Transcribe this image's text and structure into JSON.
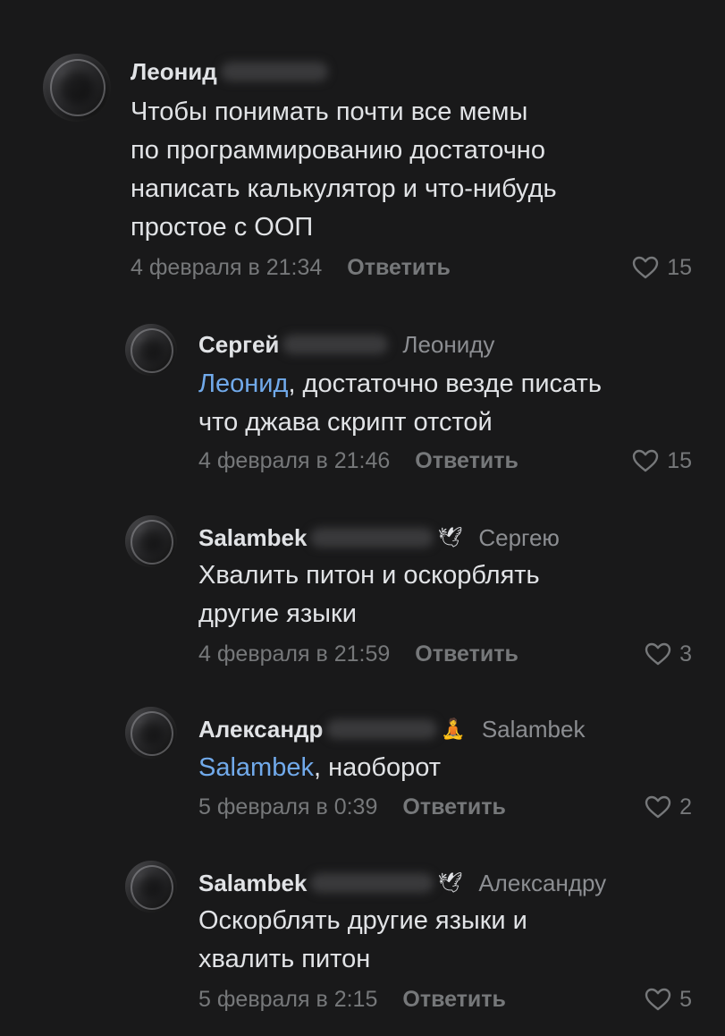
{
  "comments": [
    {
      "author": "Леонид",
      "reply_to": "",
      "text_lines": [
        "Чтобы понимать почти все мемы",
        "по программированию достаточно",
        "написать калькулятор и что-нибудь",
        "простое с ООП"
      ],
      "date": "4 февраля в 21:34",
      "reply_label": "Ответить",
      "likes": "15"
    },
    {
      "author": "Сергей",
      "reply_to": "Леониду",
      "mention": "Леонид",
      "text_first_rest": ", достаточно везде писать",
      "text_lines": [
        "что джава скрипт отстой"
      ],
      "date": "4 февраля в 21:46",
      "reply_label": "Ответить",
      "likes": "15"
    },
    {
      "author": "Salambek",
      "emoji": "🕊",
      "reply_to": "Сергею",
      "text_lines": [
        "Хвалить питон и оскорблять",
        "другие языки"
      ],
      "date": "4 февраля в 21:59",
      "reply_label": "Ответить",
      "likes": "3"
    },
    {
      "author": "Александр",
      "emoji": "🧘",
      "reply_to": "Salambek",
      "mention": "Salambek",
      "text_first_rest": ", наоборот",
      "date": "5 февраля в 0:39",
      "reply_label": "Ответить",
      "likes": "2"
    },
    {
      "author": "Salambek",
      "emoji": "🕊",
      "reply_to": "Александру",
      "text_lines": [
        "Оскорблять другие языки и",
        "хвалить питон"
      ],
      "date": "5 февраля в 2:15",
      "reply_label": "Ответить",
      "likes": "5"
    }
  ],
  "icons": {
    "like": "heart-icon"
  },
  "colors": {
    "background": "#19191a",
    "text": "#e1e3e6",
    "secondary": "#76787a",
    "mention": "#71aaeb"
  }
}
